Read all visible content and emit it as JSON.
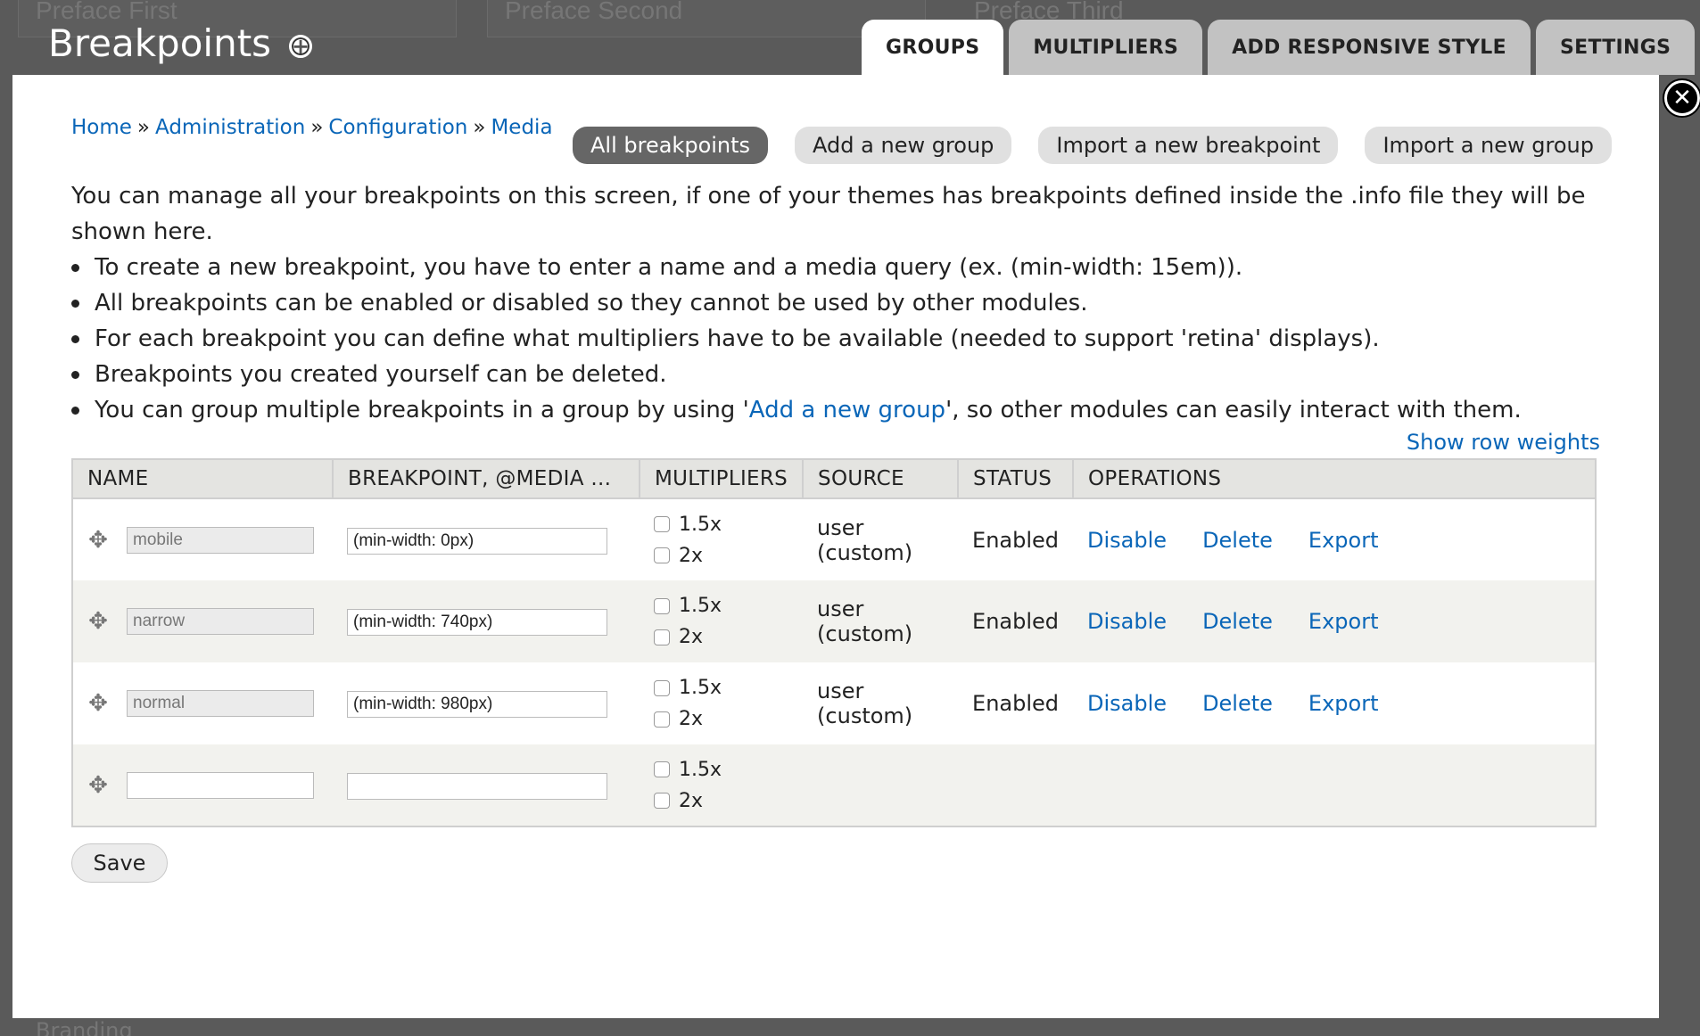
{
  "background": {
    "regions": [
      "Preface First",
      "Preface Second",
      "Preface Third"
    ],
    "bottom_label": "Branding"
  },
  "overlay": {
    "title": "Breakpoints",
    "add_shortcut_icon": "plus-circle-icon"
  },
  "tabs": [
    {
      "label": "GROUPS",
      "active": true
    },
    {
      "label": "MULTIPLIERS",
      "active": false
    },
    {
      "label": "ADD RESPONSIVE STYLE",
      "active": false
    },
    {
      "label": "SETTINGS",
      "active": false
    }
  ],
  "breadcrumb": {
    "items": [
      "Home",
      "Administration",
      "Configuration",
      "Media"
    ],
    "separator": "»"
  },
  "actions": [
    {
      "label": "All breakpoints",
      "active": true
    },
    {
      "label": "Add a new group",
      "active": false
    },
    {
      "label": "Import a new breakpoint",
      "active": false
    },
    {
      "label": "Import a new group",
      "active": false
    }
  ],
  "intro": {
    "paragraph": "You can manage all your breakpoints on this screen, if one of your themes has breakpoints defined inside the .info file they will be shown here.",
    "bullets": [
      "To create a new breakpoint, you have to enter a name and a media query (ex. (min-width: 15em)).",
      "All breakpoints can be enabled or disabled so they cannot be used by other modules.",
      "For each breakpoint you can define what multipliers have to be available (needed to support 'retina' displays).",
      "Breakpoints you created yourself can be deleted."
    ],
    "last_bullet_prefix": "You can group multiple breakpoints in a group by using '",
    "last_bullet_link": "Add a new group",
    "last_bullet_suffix": "', so other modules can easily interact with them."
  },
  "show_row_weights": "Show row weights",
  "table": {
    "headers": [
      "NAME",
      "BREAKPOINT, @MEDIA ...",
      "MULTIPLIERS",
      "SOURCE",
      "STATUS",
      "OPERATIONS"
    ],
    "rows": [
      {
        "name": "mobile",
        "media": "(min-width: 0px)",
        "multipliers": [
          "1.5x",
          "2x"
        ],
        "source": "user (custom)",
        "status": "Enabled",
        "ops": [
          "Disable",
          "Delete",
          "Export"
        ]
      },
      {
        "name": "narrow",
        "media": "(min-width: 740px)",
        "multipliers": [
          "1.5x",
          "2x"
        ],
        "source": "user (custom)",
        "status": "Enabled",
        "ops": [
          "Disable",
          "Delete",
          "Export"
        ]
      },
      {
        "name": "normal",
        "media": "(min-width: 980px)",
        "multipliers": [
          "1.5x",
          "2x"
        ],
        "source": "user (custom)",
        "status": "Enabled",
        "ops": [
          "Disable",
          "Delete",
          "Export"
        ]
      },
      {
        "name": "",
        "media": "",
        "multipliers": [
          "1.5x",
          "2x"
        ],
        "source": "",
        "status": "",
        "ops": []
      }
    ]
  },
  "save_label": "Save",
  "close_icon": "close-icon"
}
